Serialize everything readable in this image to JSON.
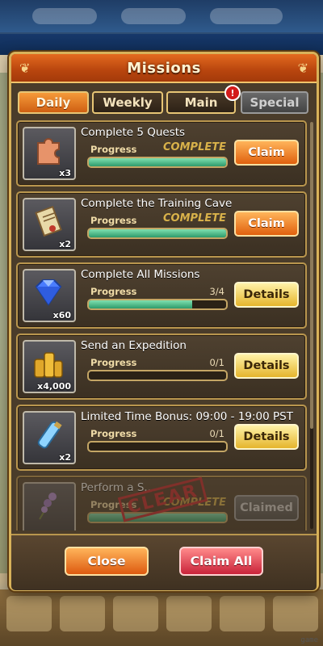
{
  "dialog": {
    "title": "Missions",
    "tabs": [
      {
        "label": "Daily",
        "state": "active"
      },
      {
        "label": "Weekly",
        "state": "inactive"
      },
      {
        "label": "Main",
        "state": "inactive",
        "badge": "!"
      },
      {
        "label": "Special",
        "state": "disabled"
      }
    ],
    "progress_label": "Progress",
    "missions": [
      {
        "title": "Complete 5 Quests",
        "reward_icon": "puzzle-piece-icon",
        "reward_qty": "x3",
        "progress_text": "COMPLETE",
        "progress_fraction": 1.0,
        "button": "Claim"
      },
      {
        "title": "Complete the Training Cave",
        "reward_icon": "scroll-icon",
        "reward_qty": "x2",
        "progress_text": "COMPLETE",
        "progress_fraction": 1.0,
        "button": "Claim"
      },
      {
        "title": "Complete All Missions",
        "reward_icon": "diamond-gem-icon",
        "reward_qty": "x60",
        "progress_text": "3/4",
        "progress_fraction": 0.75,
        "button": "Details"
      },
      {
        "title": "Send an Expedition",
        "reward_icon": "gold-coins-icon",
        "reward_qty": "x4,000",
        "progress_text": "0/1",
        "progress_fraction": 0.0,
        "button": "Details"
      },
      {
        "title": "Limited Time Bonus: 09:00 - 19:00 PST",
        "reward_icon": "potion-vial-icon",
        "reward_qty": "x2",
        "progress_text": "0/1",
        "progress_fraction": 0.0,
        "button": "Details"
      },
      {
        "title": "Perform a S...",
        "reward_icon": "flower-icon",
        "reward_qty": "",
        "progress_text": "COMPLETE",
        "progress_fraction": 1.0,
        "button": "Claimed",
        "stamp": "CLEAR"
      }
    ],
    "footer": {
      "close_label": "Close",
      "claim_all_label": "Claim All"
    }
  },
  "watermark": "game",
  "colors": {
    "title_bar": "#c8501a",
    "tab_active": "#e5771f",
    "claim_button": "#e8741a",
    "details_button": "#f0c64a",
    "claim_all_button": "#e0455a",
    "progress_fill": "#3fb07e",
    "complete_text": "#d9b24a"
  }
}
